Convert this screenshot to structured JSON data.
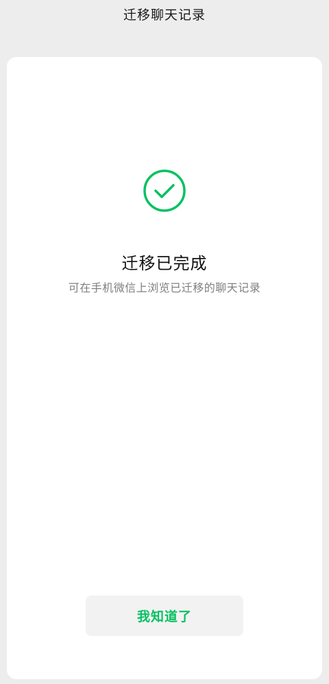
{
  "header": {
    "title": "迁移聊天记录"
  },
  "result": {
    "icon": "check-circle-icon",
    "title": "迁移已完成",
    "subtitle": "可在手机微信上浏览已迁移的聊天记录"
  },
  "actions": {
    "confirm_label": "我知道了"
  },
  "colors": {
    "accent": "#07c160",
    "page_background": "#ededed",
    "card_background": "#ffffff",
    "button_background": "#f2f2f2"
  }
}
